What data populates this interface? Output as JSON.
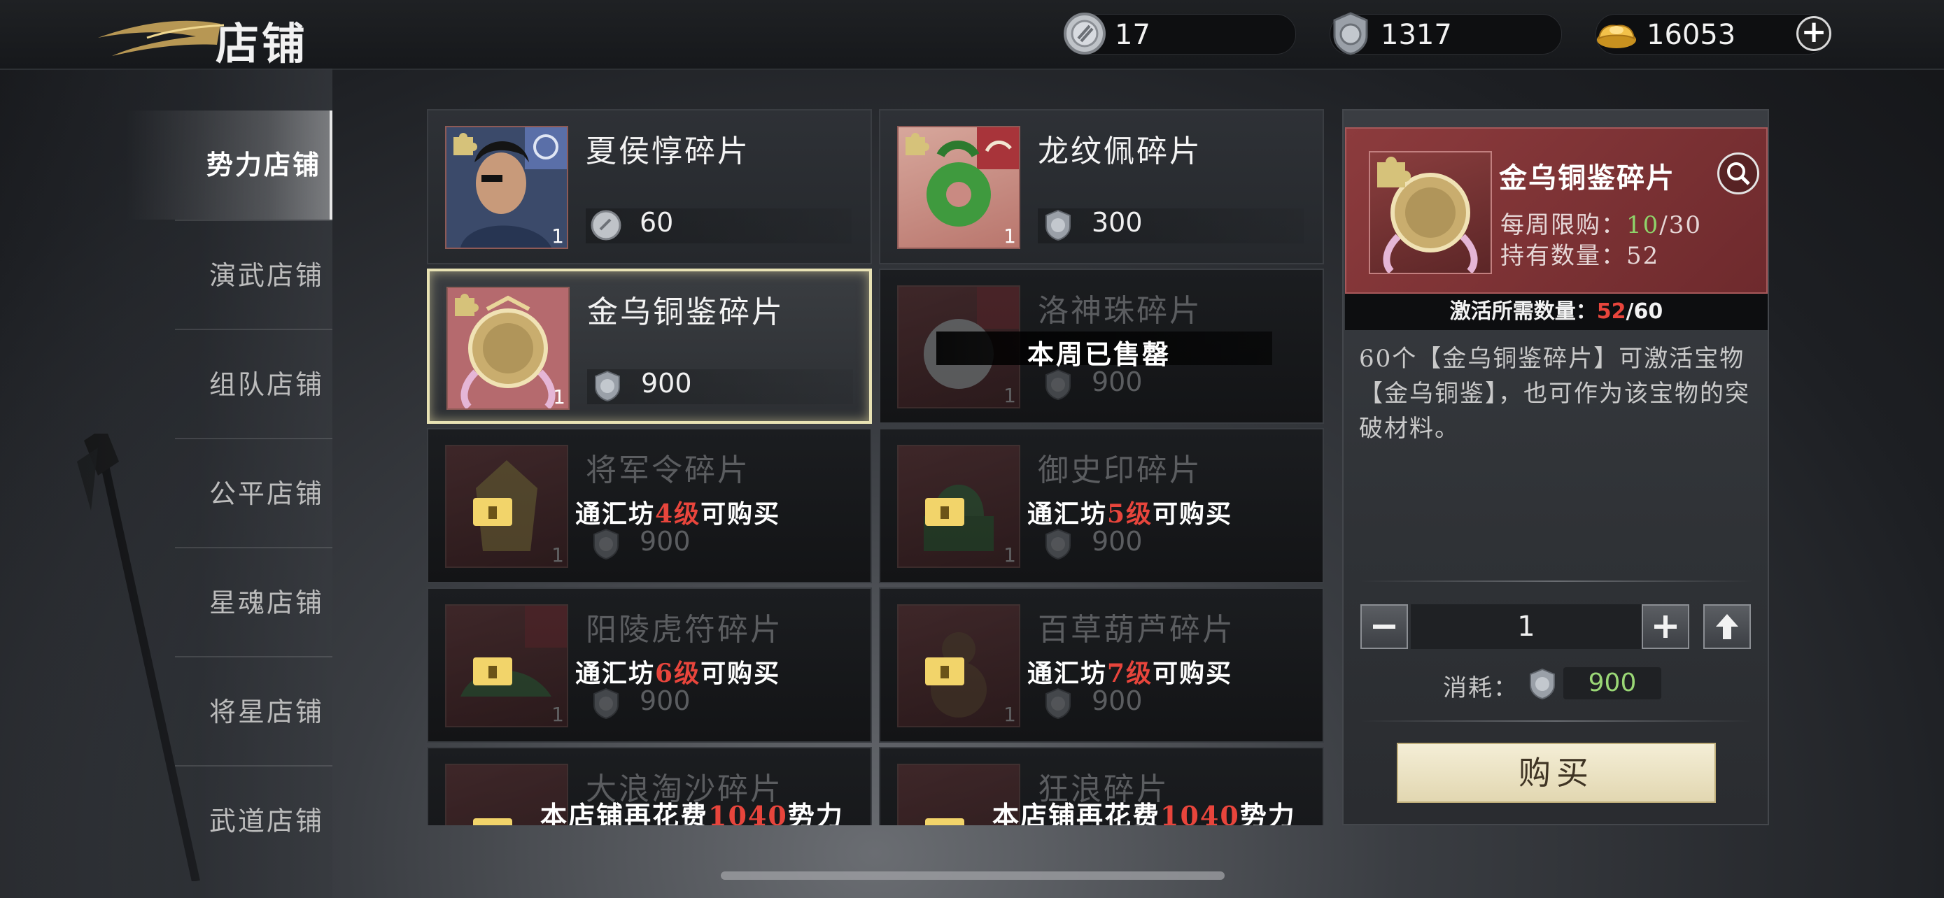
{
  "header": {
    "title": "店铺",
    "currencies": [
      {
        "icon": "silver-token-icon",
        "value": "17"
      },
      {
        "icon": "shield-coin-icon",
        "value": "1317"
      },
      {
        "icon": "gold-ingot-icon",
        "value": "16053"
      }
    ]
  },
  "sidebar": {
    "items": [
      {
        "label": "势力店铺",
        "active": true
      },
      {
        "label": "演武店铺"
      },
      {
        "label": "组队店铺"
      },
      {
        "label": "公平店铺"
      },
      {
        "label": "星魂店铺"
      },
      {
        "label": "将星店铺"
      },
      {
        "label": "武道店铺"
      }
    ]
  },
  "shop": {
    "items": [
      {
        "name": "夏侯惇碎片",
        "count": "1",
        "price": "60",
        "currency": "silver-token-icon",
        "state": "available"
      },
      {
        "name": "龙纹佩碎片",
        "count": "1",
        "price": "300",
        "currency": "shield-coin-icon",
        "state": "available"
      },
      {
        "name": "金乌铜鉴碎片",
        "count": "1",
        "price": "900",
        "currency": "shield-coin-icon",
        "state": "selected"
      },
      {
        "name": "洛神珠碎片",
        "count": "1",
        "price": "900",
        "currency": "shield-coin-icon",
        "state": "soldout",
        "overlay": "本周已售罄"
      },
      {
        "name": "将军令碎片",
        "count": "1",
        "price": "900",
        "currency": "shield-coin-icon",
        "state": "locked",
        "lock_prefix": "通汇坊",
        "lock_level": "4级",
        "lock_suffix": "可购买"
      },
      {
        "name": "御史印碎片",
        "count": "1",
        "price": "900",
        "currency": "shield-coin-icon",
        "state": "locked",
        "lock_prefix": "通汇坊",
        "lock_level": "5级",
        "lock_suffix": "可购买"
      },
      {
        "name": "阳陵虎符碎片",
        "count": "1",
        "price": "900",
        "currency": "shield-coin-icon",
        "state": "locked",
        "lock_prefix": "通汇坊",
        "lock_level": "6级",
        "lock_suffix": "可购买"
      },
      {
        "name": "百草葫芦碎片",
        "count": "1",
        "price": "900",
        "currency": "shield-coin-icon",
        "state": "locked",
        "lock_prefix": "通汇坊",
        "lock_level": "7级",
        "lock_suffix": "可购买"
      },
      {
        "name": "大浪淘沙碎片",
        "state": "spend-locked",
        "spend_prefix": "本店铺再花费",
        "spend_amount": "1040",
        "spend_suffix": "势力"
      },
      {
        "name": "狂浪碎片",
        "state": "spend-locked",
        "spend_prefix": "本店铺再花费",
        "spend_amount": "1040",
        "spend_suffix": "势力"
      }
    ]
  },
  "detail": {
    "name": "金乌铜鉴碎片",
    "weekly_limit_label": "每周限购：",
    "weekly_limit_used": "10",
    "weekly_limit_total": "/30",
    "owned_label": "持有数量：",
    "owned_value": "52",
    "required_label": "激活所需数量：",
    "required_current": "52",
    "required_total": "/60",
    "description": "60个【金乌铜鉴碎片】可激活宝物【金乌铜鉴】，也可作为该宝物的突破材料。",
    "quantity": "1",
    "cost_label": "消耗：",
    "cost_value": "900",
    "buy_label": "购买"
  },
  "colors": {
    "accent_red": "#e8453c",
    "accent_green": "#8fd36a",
    "selected_border": "#e8e2b4",
    "buy_button": "#eee6c6"
  }
}
